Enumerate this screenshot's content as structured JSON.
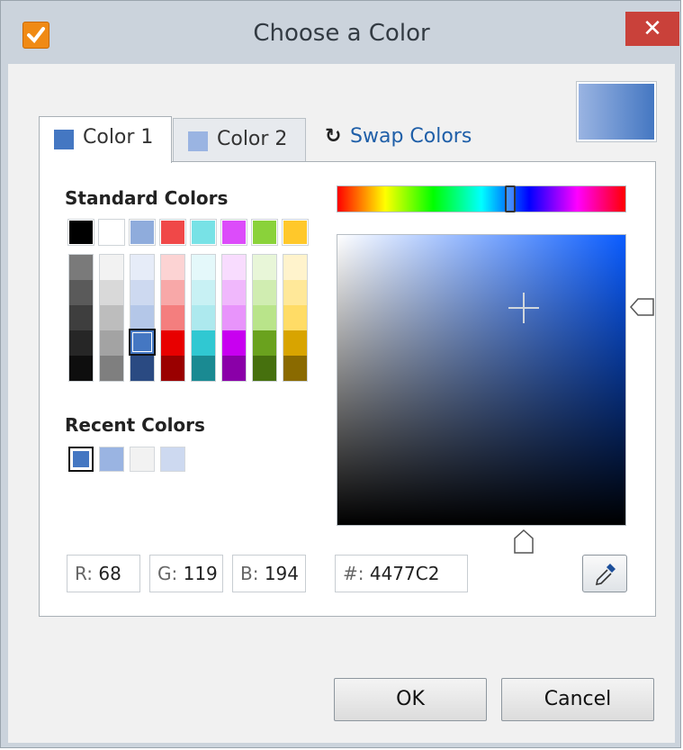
{
  "window": {
    "title": "Choose a Color",
    "close_glyph": "✕"
  },
  "preview": {
    "start": "#9ab4e2",
    "end": "#4477c2"
  },
  "tabs": [
    {
      "label": "Color 1",
      "swatch": "#4477c2",
      "active": true
    },
    {
      "label": "Color 2",
      "swatch": "#9ab4e2",
      "active": false
    }
  ],
  "swap": {
    "label": "Swap Colors",
    "icon": "↻"
  },
  "standard_colors": {
    "title": "Standard Colors",
    "top_row": [
      "#000000",
      "#ffffff",
      "#8facdc",
      "#f04848",
      "#78e2e6",
      "#dc4cfa",
      "#8ad23a",
      "#ffc82a"
    ],
    "shades": [
      [
        "#7a7a7a",
        "#5a5a5a",
        "#3e3e3e",
        "#262626",
        "#0e0e0e"
      ],
      [
        "#f2f2f2",
        "#d9d9d9",
        "#bdbdbd",
        "#a3a3a3",
        "#7f7f7f"
      ],
      [
        "#e6ecf8",
        "#cdd9f0",
        "#b4c7e8",
        "#4477c2",
        "#2a4a82"
      ],
      [
        "#fcd3d3",
        "#f8a8a8",
        "#f47e7e",
        "#e80000",
        "#9a0000"
      ],
      [
        "#e4f8fa",
        "#c8f1f4",
        "#ade9ee",
        "#30c8d2",
        "#1a8a92"
      ],
      [
        "#f8dcfe",
        "#f0b8fc",
        "#e894fb",
        "#c800f0",
        "#8a00a8"
      ],
      [
        "#e8f6d8",
        "#d0edb1",
        "#b9e48a",
        "#6aa21e",
        "#46700e"
      ],
      [
        "#fff3cc",
        "#ffe899",
        "#ffdc66",
        "#d8a400",
        "#8a6a00"
      ]
    ],
    "selected": {
      "column": 2,
      "row": 3
    }
  },
  "recent_colors": {
    "title": "Recent Colors",
    "swatches": [
      "#4477c2",
      "#9ab4e2",
      "#f2f2f2",
      "#cdd9f0"
    ],
    "selected_index": 0
  },
  "rgb": {
    "r_label": "R:",
    "r_value": "68",
    "g_label": "G:",
    "g_value": "119",
    "b_label": "B:",
    "b_value": "194"
  },
  "hex": {
    "label": "#:",
    "value": "4477C2"
  },
  "picker": {
    "hue_degrees": 216,
    "saturation": 0.65,
    "value": 0.76
  },
  "eyedropper_icon": "eyedropper-icon",
  "buttons": {
    "ok": "OK",
    "cancel": "Cancel"
  }
}
